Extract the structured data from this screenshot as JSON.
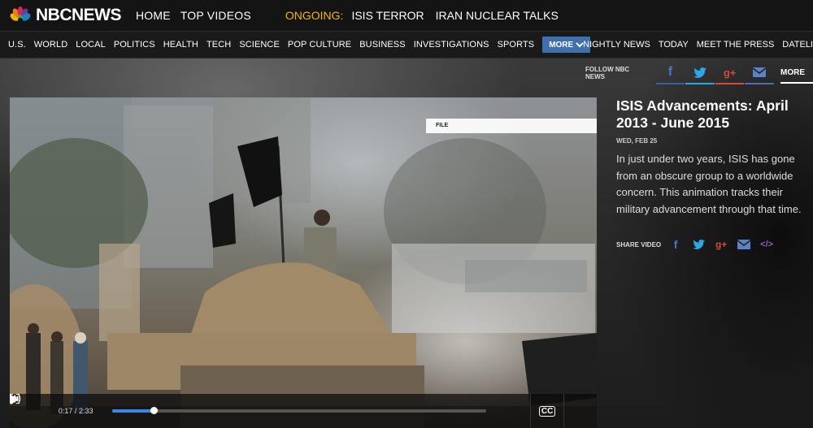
{
  "header": {
    "logo_text": "NBCNEWS",
    "top_links": [
      "HOME",
      "TOP VIDEOS"
    ],
    "ongoing_label": "ONGOING:",
    "ongoing_items": [
      "ISIS TERROR",
      "IRAN NUCLEAR TALKS"
    ]
  },
  "sections": [
    "U.S.",
    "WORLD",
    "LOCAL",
    "POLITICS",
    "HEALTH",
    "TECH",
    "SCIENCE",
    "POP CULTURE",
    "BUSINESS",
    "INVESTIGATIONS",
    "SPORTS"
  ],
  "more_button": "MORE",
  "shows": [
    "NIGHTLY NEWS",
    "TODAY",
    "MEET THE PRESS",
    "DATELI"
  ],
  "follow": {
    "label": "FOLLOW NBC NEWS",
    "more_tab": "MORE"
  },
  "video": {
    "file_label": "FILE",
    "current_time": "0:17",
    "duration": "2:33",
    "progress_fraction": 0.11
  },
  "article": {
    "title": "ISIS Advancements: April 2013 - June 2015",
    "date": "WED, FEB 25",
    "description": "In just under two years, ISIS has gone from an obscure group to a worldwide concern. This animation tracks their military advancement through that time.",
    "share_label": "SHARE VIDEO"
  },
  "colors": {
    "ongoing": "#f5b700",
    "more_button": "#3f6fad",
    "progress": "#3a86e8",
    "facebook": "#3b5ea8",
    "twitter": "#2ea6e6",
    "google_plus": "#d34b3a"
  }
}
